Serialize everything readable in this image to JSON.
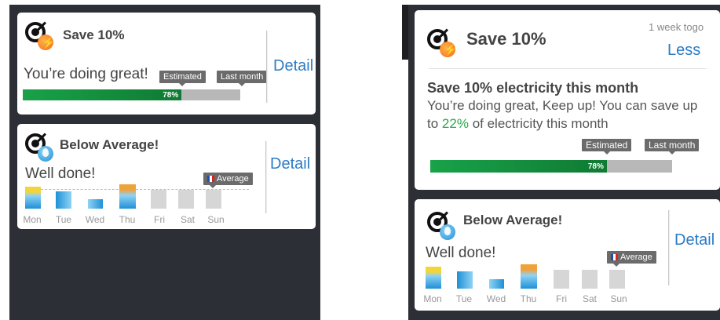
{
  "left_panel": {
    "save_card": {
      "title": "Save 10%",
      "message": "You’re doing great!",
      "detail_link": "Detail",
      "estimated_label": "Estimated",
      "last_month_label": "Last month",
      "progress_value": 0.78,
      "progress_label": "78%"
    },
    "average_card": {
      "title": "Below Average!",
      "message": "Well done!",
      "detail_link": "Detail",
      "average_label": "Average",
      "days": [
        "Mon",
        "Tue",
        "Wed",
        "Thu",
        "Fri",
        "Sat",
        "Sun"
      ]
    }
  },
  "right_panel": {
    "save_card": {
      "title": "Save 10%",
      "time_left": "1 week togo",
      "less_link": "Less",
      "heading": "Save 10% electricity this month",
      "message_line1": "You’re doing great, Keep up! You can save up",
      "message_prefix": "to",
      "highlight": "22%",
      "message_suffix": "of electricity this month",
      "estimated_label": "Estimated",
      "last_month_label": "Last month",
      "progress_value": 0.78,
      "progress_label": "78%"
    },
    "average_card": {
      "title": "Below Average!",
      "message": "Well done!",
      "detail_link": "Detail",
      "average_label": "Average",
      "days": [
        "Mon",
        "Tue",
        "Wed",
        "Thu",
        "Fri",
        "Sat",
        "Sun"
      ]
    }
  },
  "colors": {
    "accent_blue": "#2b7bc6",
    "progress_green": "#18a249",
    "highlight_green": "#2aa84a",
    "water_blue": "#1e90d6",
    "bar_yellow": "#f3d53a",
    "bar_orange": "#f0a23a",
    "inactive_bar": "#d6d6d6",
    "tag_gray": "#6b6b6b"
  },
  "icons": {
    "goal": "target-icon",
    "energy": "bolt-icon",
    "water": "water-drop-icon"
  }
}
